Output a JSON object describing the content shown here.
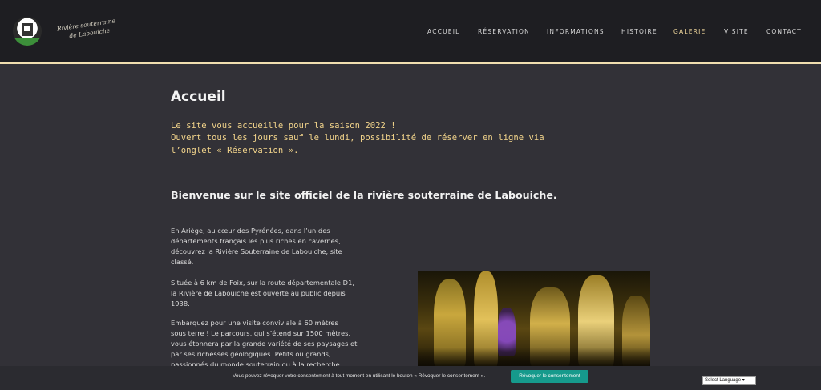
{
  "logo": {
    "script_line1": "Rivière souterraine",
    "script_line2": "de Labouiche"
  },
  "nav": {
    "items": [
      {
        "label": "ACCUEIL"
      },
      {
        "label": "RÉSERVATION"
      },
      {
        "label": "INFORMATIONS"
      },
      {
        "label": "HISTOIRE"
      },
      {
        "label": "GALERIE"
      },
      {
        "label": "VISITE"
      },
      {
        "label": "CONTACT"
      }
    ],
    "active_color": "#f0d79c"
  },
  "main": {
    "title": "Accueil",
    "notice_lines": [
      "Le site vous accueille pour la saison 2022 !",
      "Ouvert tous les jours sauf le lundi, possibilité de réserver en ligne via",
      "l’onglet « Réservation »."
    ],
    "welcome_heading": "Bienvenue sur le site officiel de la rivière souterraine de Labouiche.",
    "paragraph_lines": [
      "En Ariège, au cœur des Pyrénées, dans l’un des",
      "départements français les plus riches en cavernes,",
      "découvrez la Rivière Souterraine de Labouiche, site",
      "classé.",
      "Située à 6 km de Foix, sur la route départementale D1,",
      "la Rivière de Labouiche est ouverte au public depuis",
      "1938.",
      "Embarquez pour une visite conviviale à 60 mètres",
      "sous terre ! Le parcours, qui s’étend sur 1500 mètres,",
      "vous étonnera par la grande variété de ses paysages et",
      "par ses richesses géologiques. Petits ou grands,",
      "passionnés du monde souterrain ou à la recherche"
    ]
  },
  "consent": {
    "text": "Vous pouvez révoquer votre consentement à tout moment en utilisant le bouton « Révoquer le consentement ».",
    "button_label": "Révoquer le consentement",
    "button_color": "#169a8c"
  },
  "language": {
    "selected": "Select Language"
  },
  "colors": {
    "header_bg": "#1e1e22",
    "accent_line": "#f1dfb0",
    "page_bg": "#323137",
    "notice_text": "#f2d48b"
  }
}
